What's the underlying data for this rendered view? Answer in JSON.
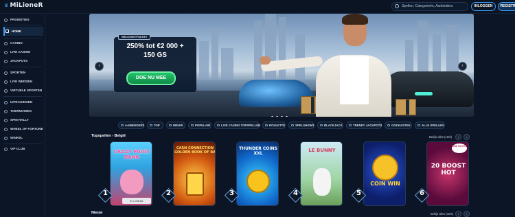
{
  "header": {
    "logo": "MiLioneR",
    "search_placeholder": "Spellen, Categorieën, Aanbieders",
    "login_label": "INLOGGEN",
    "register_label": "REGISTREREN"
  },
  "sidebar": {
    "items": [
      {
        "label": "PROMOTIES",
        "icon": "gift-icon"
      },
      {
        "label": "HOME",
        "icon": "home-icon",
        "active": true
      },
      {
        "label": "CASINO",
        "icon": "cards-icon"
      },
      {
        "label": "LIVE CASINO",
        "icon": "live-icon"
      },
      {
        "label": "JACKPOTS",
        "icon": "jackpot-icon"
      },
      {
        "label": "SPORTEN",
        "icon": "ball-icon"
      },
      {
        "label": "LIVE WEDDEN",
        "icon": "live-bet-icon"
      },
      {
        "label": "VIRTUELE SPORTEN",
        "icon": "virtual-icon"
      },
      {
        "label": "UITDAGINGEN",
        "icon": "target-icon"
      },
      {
        "label": "TOERNOOIEN",
        "icon": "trophy-icon"
      },
      {
        "label": "SPIN RALLY",
        "icon": "spin-icon"
      },
      {
        "label": "WHEEL OF FORTUNE",
        "icon": "wheel-icon"
      },
      {
        "label": "WINKEL",
        "icon": "shop-icon"
      },
      {
        "label": "VIP CLUB",
        "icon": "crown-icon"
      }
    ]
  },
  "banner": {
    "tag": "WELKOMSTPAKKET",
    "line1": "250% tot €2 000 +",
    "line2": "150 GS",
    "cta": "DOE NU MEE",
    "prev_icon": "chevron-left-icon",
    "next_icon": "chevron-right-icon",
    "slide_count": 4,
    "active_slide": 1
  },
  "filters": [
    {
      "label": "AANBIEDERS"
    },
    {
      "label": "TOP"
    },
    {
      "label": "NIEUW"
    },
    {
      "label": "POPULAIR"
    },
    {
      "label": "LIVE CASINO TOPSPELLEN"
    },
    {
      "label": "ROULETTE"
    },
    {
      "label": "SPELSHOWS"
    },
    {
      "label": "BLACKJACK"
    },
    {
      "label": "TRENDY JACKPOTS"
    },
    {
      "label": "GOKKASTEN"
    },
    {
      "label": "ALLE SPELLEN"
    }
  ],
  "top_games": {
    "title": "Topspellen - België",
    "view_all": "Bekijk alles (10/6)",
    "games": [
      {
        "rank": "1",
        "name": "CRAZY PIGGY BANK",
        "price": "€ 1 025.62"
      },
      {
        "rank": "2",
        "name": "CASH CONNECTION GOLDEN BOOK OF RA"
      },
      {
        "rank": "3",
        "name": "THUNDER COINS XXL"
      },
      {
        "rank": "4",
        "name": "LE BUNNY"
      },
      {
        "rank": "5",
        "name": "COIN WIN"
      },
      {
        "rank": "6",
        "name": "20 BOOST HOT",
        "badge": "LINE BOOST"
      }
    ]
  },
  "new_games": {
    "title": "Nieuw",
    "view_all": "Bekijk alles (32/6)"
  }
}
